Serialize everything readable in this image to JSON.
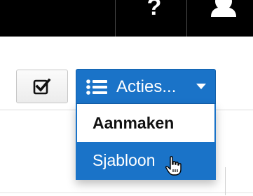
{
  "topbar": {
    "help_icon": "question-mark-icon",
    "help_glyph": "?",
    "user_icon": "user-icon"
  },
  "toolbar": {
    "select_all_icon": "checkbox-icon",
    "actions_button": {
      "label": "Acties...",
      "icon": "list-icon",
      "caret": "chevron-down-icon"
    }
  },
  "dropdown": {
    "items": [
      {
        "label": "Aanmaken",
        "state": "normal"
      },
      {
        "label": "Sjabloon",
        "state": "hovered"
      }
    ]
  },
  "colors": {
    "accent": "#1a73c8",
    "topbar": "#000000",
    "text": "#111111"
  }
}
